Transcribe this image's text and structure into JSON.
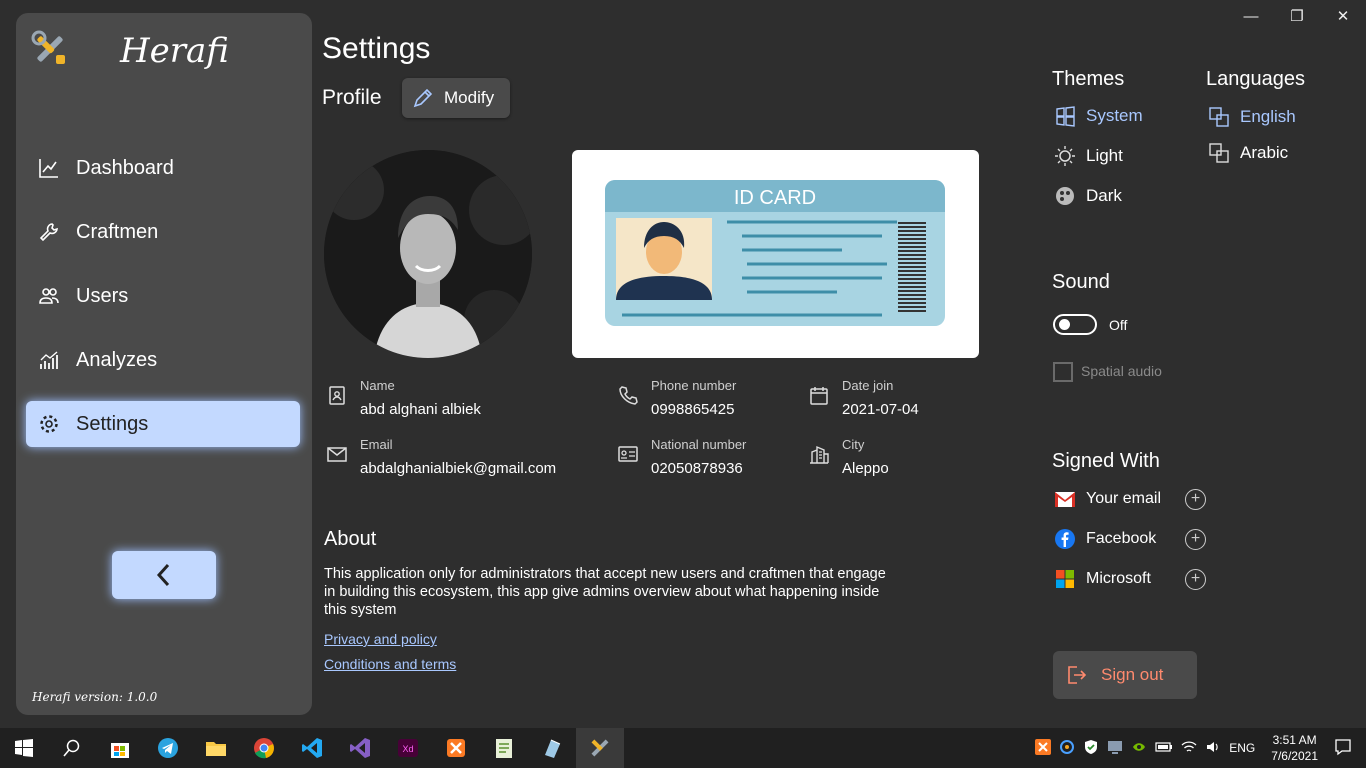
{
  "app": {
    "name": "Herafi",
    "version_label": "Herafi version: 1.0.0"
  },
  "window_controls": [
    "—",
    "❐",
    "✕"
  ],
  "sidebar": {
    "items": [
      {
        "label": "Dashboard",
        "icon": "chart-line-icon"
      },
      {
        "label": "Craftmen",
        "icon": "wrench-icon"
      },
      {
        "label": "Users",
        "icon": "users-icon"
      },
      {
        "label": "Analyzes",
        "icon": "analytics-icon"
      },
      {
        "label": "Settings",
        "icon": "gear-icon",
        "active": true
      }
    ]
  },
  "page": {
    "title": "Settings",
    "profile_label": "Profile",
    "modify_label": "Modify",
    "idcard_title": "ID CARD"
  },
  "profile": {
    "name_label": "Name",
    "name": "abd alghani albiek",
    "phone_label": "Phone number",
    "phone": "0998865425",
    "date_label": "Date join",
    "date": "2021-07-04",
    "email_label": "Email",
    "email": "abdalghanialbiek@gmail.com",
    "national_label": "National number",
    "national": "02050878936",
    "city_label": "City",
    "city": "Aleppo"
  },
  "about": {
    "heading": "About",
    "text": "This application only for administrators that accept new users and craftmen that engage\n in building this ecosystem,  this app give admins overview about what happening inside\n this system",
    "privacy": "Privacy and policy",
    "terms": "Conditions and terms"
  },
  "themes": {
    "heading": "Themes",
    "options": [
      "System",
      "Light",
      "Dark"
    ],
    "selected": "System"
  },
  "languages": {
    "heading": "Languages",
    "options": [
      "English",
      "Arabic"
    ],
    "selected": "English"
  },
  "sound": {
    "heading": "Sound",
    "toggle_label": "Off",
    "spatial_label": "Spatial audio"
  },
  "signed_with": {
    "heading": "Signed With",
    "items": [
      "Your email",
      "Facebook",
      "Microsoft"
    ]
  },
  "signout_label": "Sign out",
  "taskbar": {
    "language": "ENG",
    "time": "3:51 AM",
    "date": "7/6/2021"
  },
  "colors": {
    "accent": "#c3d9ff",
    "selected_text": "#a9c8ff",
    "signout": "#ff8a6e"
  }
}
